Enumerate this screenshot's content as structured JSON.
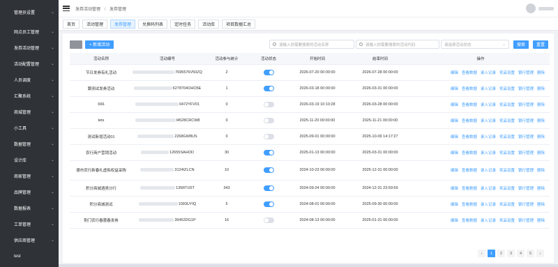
{
  "sidebar": {
    "items": [
      {
        "label": "管理员设置",
        "chevron": true
      },
      {
        "label": "网点员工管理",
        "chevron": true
      },
      {
        "label": "发券活动管理",
        "chevron": true
      },
      {
        "label": "活动配置管理",
        "chevron": true
      },
      {
        "label": "人员调度",
        "chevron": true
      },
      {
        "label": "汇聚系统",
        "chevron": true
      },
      {
        "label": "商城管理",
        "chevron": true
      },
      {
        "label": "小工具",
        "chevron": true
      },
      {
        "label": "数据管理",
        "chevron": true
      },
      {
        "label": "设计库",
        "chevron": true
      },
      {
        "label": "商家管理",
        "chevron": true
      },
      {
        "label": "品牌管理",
        "chevron": true
      },
      {
        "label": "数据报表",
        "chevron": true
      },
      {
        "label": "工单管理",
        "chevron": true
      },
      {
        "label": "供应商管理",
        "chevron": true
      },
      {
        "label": "test",
        "chevron": false
      }
    ]
  },
  "header": {
    "breadcrumb": [
      "发券活动管理",
      "发券管理"
    ]
  },
  "tabs": [
    {
      "label": "首页",
      "active": false
    },
    {
      "label": "活动管理",
      "active": false
    },
    {
      "label": "发券管理",
      "active": true
    },
    {
      "label": "兑换码列表",
      "active": false
    },
    {
      "label": "定时任务",
      "active": false
    },
    {
      "label": "活动库",
      "active": false
    },
    {
      "label": "项目数据汇总",
      "active": false
    }
  ],
  "toolbar": {
    "add_label": "+ 新增活动",
    "name_placeholder": "请输入你需要搜索的活动名称",
    "code_placeholder": "请输入你需要搜索的活动代码",
    "status_placeholder": "请选择活动状态",
    "search_label": "搜索",
    "reset_label": "重置"
  },
  "table": {
    "columns": [
      "活动名称",
      "活动编号",
      "活动参与统计",
      "活动状态",
      "开始时间",
      "结束时间",
      "操作"
    ],
    "operations": [
      "编辑",
      "查看数据",
      "录入记录",
      "奖品设置",
      "银行管理",
      "删除"
    ],
    "rows": [
      {
        "name": "节日发券有礼活动",
        "code": "7695576V50ZQ",
        "count": "2",
        "status": "on",
        "start": "2026-07-20 00:00:00",
        "end": "2026-07-28 00:00:00"
      },
      {
        "name": "跟测试发券活动",
        "code": "6278704OHO5E",
        "count": "1",
        "status": "on",
        "start": "2026-03-18 00:00:00",
        "end": "2026-03-31 00:00:00"
      },
      {
        "name": "666",
        "code": "0472YFV01",
        "count": "0",
        "status": "off",
        "start": "2026-03-19 10:10:28",
        "end": "2026-03-28 00:00:00"
      },
      {
        "name": "tets",
        "code": "I4528CRCW8",
        "count": "0",
        "status": "off",
        "start": "2025-11-20 00:00:00",
        "end": "2025-11-21 00:00:00"
      },
      {
        "name": "测试新增活动01",
        "code": "2268GW8US",
        "count": "0",
        "status": "off",
        "start": "2025-09-01 00:00:00",
        "end": "2025-10-09 14:17:27"
      },
      {
        "name": "农行商户营销活动",
        "code": "12655SAHOD",
        "count": "30",
        "status": "on",
        "start": "2025-01-13 00:00:00",
        "end": "2025-03-31 00:00:00"
      },
      {
        "name": "德市农行新春礼虚拟权益采购",
        "code": "3124IZLCN",
        "count": "10",
        "status": "on",
        "start": "2024-10-23 00:00:00",
        "end": "2025-12-31 00:00:00"
      },
      {
        "name": "积分商城酒类分行",
        "code": "135RTU5T",
        "count": "343",
        "status": "on",
        "start": "2024-09-24 00:00:00",
        "end": "2024-12-31 23:59:59"
      },
      {
        "name": "积分商城测试",
        "code": "1093UYIQ",
        "count": "5",
        "status": "on",
        "start": "2024-08-01 00:00:00",
        "end": "2025-09-30 00:00:00"
      },
      {
        "name": "荆门农行春蕾春发券",
        "code": "39452DG1P",
        "count": "16",
        "status": "off",
        "start": "2024-08-13 00:00:00",
        "end": "2025-01-31 00:00:00"
      }
    ]
  },
  "pagination": {
    "prev": "‹",
    "pages": [
      "1",
      "2",
      "3",
      "4",
      "5"
    ],
    "active": "1",
    "next": "›"
  }
}
